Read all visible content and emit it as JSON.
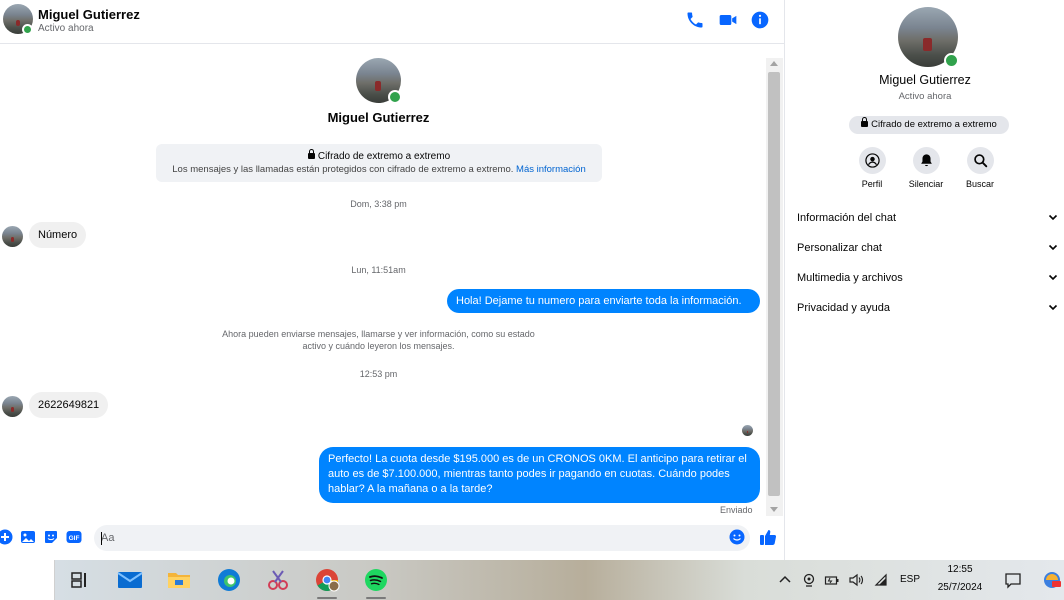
{
  "contact": {
    "name": "Miguel Gutierrez",
    "status": "Activo ahora"
  },
  "e2e": {
    "title": "Cifrado de extremo a extremo",
    "description": "Los mensajes y las llamadas están protegidos con cifrado de extremo a extremo.",
    "link": "Más información"
  },
  "messages": {
    "ts1": "Dom, 3:38 pm",
    "incoming1": "Número",
    "ts2": "Lun, 11:51am",
    "outgoing1": "Hola! Dejame tu numero  para enviarte toda la información.",
    "system_line1": "Ahora pueden enviarse mensajes, llamarse y ver información, como su estado",
    "system_line2": "activo y cuándo leyeron los mensajes.",
    "ts3": "12:53 pm",
    "incoming2": "2622649821",
    "outgoing2": "Perfecto! La cuota desde $195.000 es de un CRONOS 0KM. El anticipo para retirar el auto es de $7.100.000, mientras tanto podes ir pagando en cuotas. Cuándo podes hablar? A la mañana o a la tarde?",
    "sent_label": "Enviado"
  },
  "composer": {
    "placeholder": "Aa"
  },
  "right_panel": {
    "e2e_chip": "Cifrado de extremo a extremo",
    "actions": [
      {
        "label": "Perfil",
        "icon": "profile-icon"
      },
      {
        "label": "Silenciar",
        "icon": "bell-icon"
      },
      {
        "label": "Buscar",
        "icon": "search-icon"
      }
    ],
    "sections": [
      "Información del chat",
      "Personalizar chat",
      "Multimedia y archivos",
      "Privacidad y ayuda"
    ]
  },
  "taskbar": {
    "language": "ESP",
    "time": "12:55",
    "date": "25/7/2024",
    "apps": [
      "task-view-icon",
      "mail-icon",
      "file-explorer-icon",
      "edge-icon",
      "snipping-tool-icon",
      "chrome-icon",
      "spotify-icon"
    ]
  },
  "colors": {
    "accent": "#0084ff",
    "icon_blue": "#0866ff",
    "online": "#31a24c",
    "bubble_in": "#f0f0f0"
  }
}
